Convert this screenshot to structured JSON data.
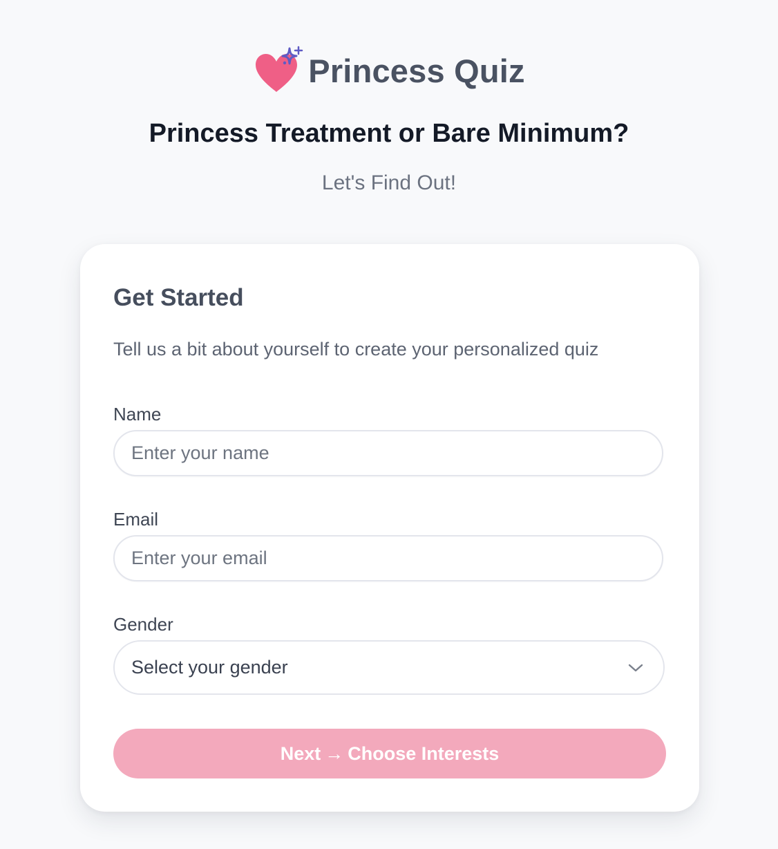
{
  "brand": {
    "title": "Princess Quiz",
    "logo_icon": "heart-sparkle-icon",
    "heart_color": "#ef5f86",
    "sparkle_color": "#5e5bc4"
  },
  "hero": {
    "headline": "Princess Treatment or Bare Minimum?",
    "subline": "Let's Find Out!"
  },
  "form": {
    "title": "Get Started",
    "description": "Tell us a bit about yourself to create your personalized quiz",
    "name": {
      "label": "Name",
      "placeholder": "Enter your name",
      "value": ""
    },
    "email": {
      "label": "Email",
      "placeholder": "Enter your email",
      "value": ""
    },
    "gender": {
      "label": "Gender",
      "selected": "Select your gender",
      "icon": "chevron-down-icon"
    },
    "submit": {
      "label": "Next",
      "arrow": "→",
      "suffix": "Choose Interests",
      "color": "#f3a9bc"
    }
  }
}
